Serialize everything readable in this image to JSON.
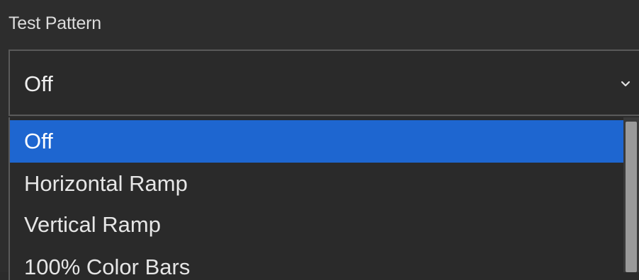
{
  "field": {
    "label": "Test Pattern",
    "selected_value": "Off",
    "chevron_icon": "chevron-down-icon"
  },
  "dropdown": {
    "options": [
      {
        "label": "Off",
        "selected": true
      },
      {
        "label": "Horizontal Ramp",
        "selected": false
      },
      {
        "label": "Vertical Ramp",
        "selected": false
      },
      {
        "label": "100% Color Bars",
        "selected": false
      }
    ]
  },
  "colors": {
    "background": "#2d2d2d",
    "selected_option": "#1e66d0",
    "text": "#e6e6e6",
    "border": "#5a5a5a"
  }
}
